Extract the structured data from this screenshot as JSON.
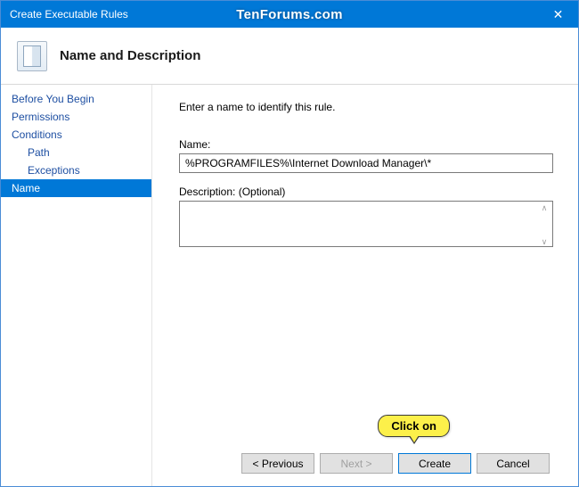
{
  "window": {
    "title": "Create Executable Rules",
    "close_glyph": "✕",
    "watermark": "TenForums.com"
  },
  "header": {
    "title": "Name and Description"
  },
  "sidebar": {
    "steps": [
      {
        "label": "Before You Begin",
        "indent": false,
        "selected": false
      },
      {
        "label": "Permissions",
        "indent": false,
        "selected": false
      },
      {
        "label": "Conditions",
        "indent": false,
        "selected": false
      },
      {
        "label": "Path",
        "indent": true,
        "selected": false
      },
      {
        "label": "Exceptions",
        "indent": true,
        "selected": false
      },
      {
        "label": "Name",
        "indent": false,
        "selected": true
      }
    ]
  },
  "content": {
    "instruction": "Enter a name to identify this rule.",
    "name_label": "Name:",
    "name_value": "%PROGRAMFILES%\\Internet Download Manager\\*",
    "desc_label": "Description: (Optional)",
    "desc_value": ""
  },
  "buttons": {
    "previous": "< Previous",
    "next": "Next >",
    "create": "Create",
    "cancel": "Cancel"
  },
  "annotation": {
    "callout": "Click on"
  }
}
